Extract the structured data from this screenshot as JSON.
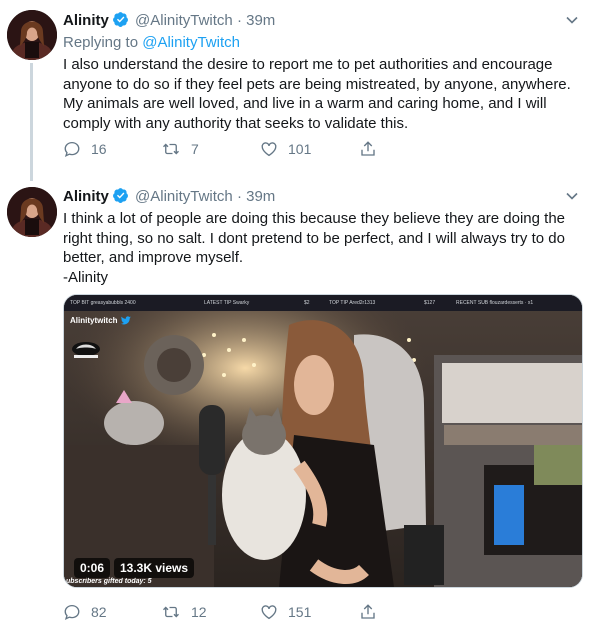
{
  "accent_color": "#1da1f2",
  "tweets": [
    {
      "author_name": "Alinity",
      "handle": "@AlinityTwitch",
      "separator": "·",
      "time": "39m",
      "replying_label": "Replying to",
      "replying_to": "@AlinityTwitch",
      "text": "I also understand the desire to report me to pet authorities and encourage anyone to do so if they feel pets are being mistreated, by anyone, anywhere. My animals are well loved, and live in a warm and caring home, and I will comply with any authority that seeks to validate this.",
      "replies": "16",
      "retweets": "7",
      "likes": "101"
    },
    {
      "author_name": "Alinity",
      "handle": "@AlinityTwitch",
      "separator": "·",
      "time": "39m",
      "text": "I think a lot of people are doing this because they believe they are doing the right thing, so no salt. I dont pretend to be perfect, and I will always try to do better, and improve myself.\n-Alinity",
      "replies": "82",
      "retweets": "12",
      "likes": "151",
      "video": {
        "duration": "0:06",
        "views": "13.3K views",
        "overlay_top_bit": "TOP BIT greasyabubbls 2400",
        "overlay_latest_tip": "LATEST TIP Swarky",
        "overlay_tip_amount": "$2",
        "overlay_top_tip": "TOP TIP Ared2r1313",
        "overlay_top_tip_amount": "$127",
        "overlay_recent_sub": "RECENT SUB flouzardesserts · x1",
        "streamer_tag": "Alinitytwitch",
        "ticker": "ubscribers gifted today: 5"
      }
    }
  ]
}
